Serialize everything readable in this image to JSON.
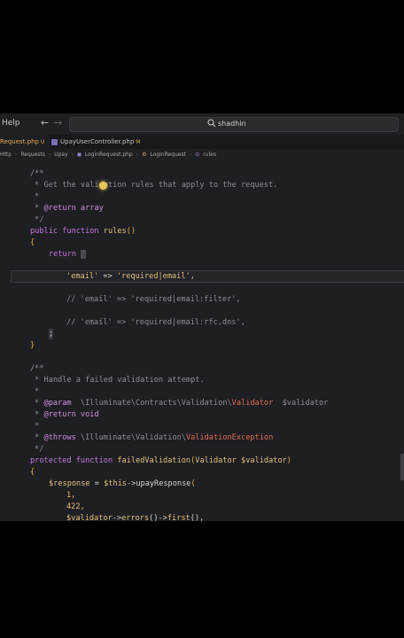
{
  "menu": {
    "help": "Help"
  },
  "search": {
    "text": "shadhin"
  },
  "tabs": [
    {
      "label": "Request.php",
      "flag": "U"
    },
    {
      "label": "UpayUserController.php",
      "flag": "M"
    }
  ],
  "breadcrumb": [
    "Http",
    "Requests",
    "Upay",
    "LoginRequest.php",
    "LoginRequest",
    "rules"
  ],
  "code": {
    "l1": "/**",
    "l2": " * Get the validation rules that apply to the request.",
    "l3": " *",
    "l4a": " * ",
    "l4b": "@return",
    "l4c": " array",
    "l5": " */",
    "l6a": "public function ",
    "l6b": "rules",
    "l6c": "()",
    "l7": "{",
    "l8": "return",
    "l9a": "'email'",
    "l9b": " => ",
    "l9c": "'required|email'",
    "l9d": ",",
    "l10": "// 'email' => 'required|email:filter',",
    "l11": "// 'email' => 'required|email:rfc,dns',",
    "l12": ";",
    "l13": "}",
    "l14": "/**",
    "l15": " * Handle a failed validation attempt.",
    "l16": " *",
    "l17a": " * ",
    "l17b": "@param",
    "l17c": "  \\Illuminate\\Contracts\\Validation\\",
    "l17d": "Validator",
    "l17e": "  $validator",
    "l18a": " * ",
    "l18b": "@return",
    "l18c": " void",
    "l19": " *",
    "l20a": " * ",
    "l20b": "@throws",
    "l20c": " \\Illuminate\\Validation\\",
    "l20d": "ValidationException",
    "l21": " */",
    "l22a": "protected function ",
    "l22b": "failedValidation",
    "l22c": "(",
    "l22d": "Validator",
    "l22e": " $validator",
    "l22f": ")",
    "l23": "{",
    "l24a": "$response",
    "l24b": " = ",
    "l24c": "$this",
    "l24d": "->",
    "l24e": "upayResponse",
    "l24f": "(",
    "l25": "1,",
    "l26": "422,",
    "l27a": "$validator",
    "l27b": "->",
    "l27c": "errors",
    "l27d": "()->",
    "l27e": "first",
    "l27f": "(),"
  }
}
